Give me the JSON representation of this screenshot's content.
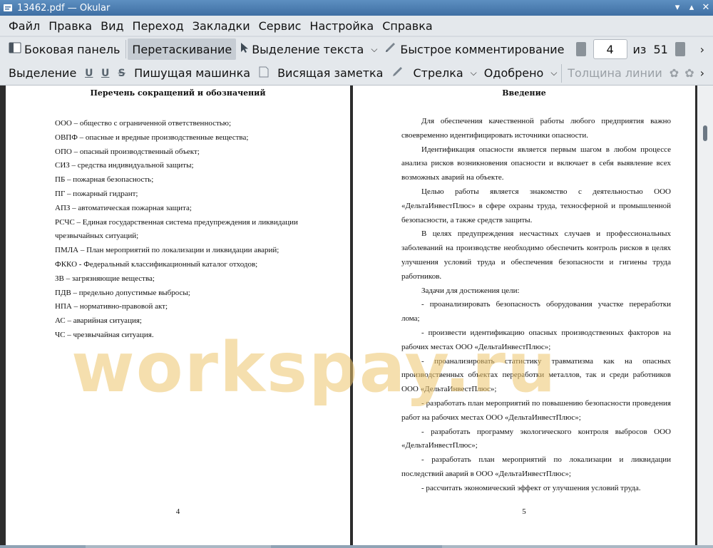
{
  "window": {
    "title": "13462.pdf — Okular"
  },
  "menu": [
    "Файл",
    "Правка",
    "Вид",
    "Переход",
    "Закладки",
    "Сервис",
    "Настройка",
    "Справка"
  ],
  "toolbar1": {
    "sidebar": "Боковая панель",
    "browse": "Перетаскивание",
    "text_select": "Выделение текста",
    "quick_annotate": "Быстрое комментирование",
    "page_current": "4",
    "page_of": "из",
    "page_total": "51"
  },
  "toolbar2": {
    "highlight": "Выделение",
    "typewriter": "Пишущая машинка",
    "popup_note": "Висящая заметка",
    "arrow": "Стрелка",
    "approved": "Одобрено",
    "line_width": "Толщина линии"
  },
  "left_page": {
    "heading": "Перечень сокращений и обозначений",
    "items": [
      "ООО – общество с ограниченной ответственностью;",
      "ОВПФ – опасные и вредные производственные вещества;",
      "ОПО – опасный производственный объект;",
      "СИЗ – средства индивидуальной защиты;",
      "ПБ – пожарная безопасность;",
      "ПГ – пожарный гидрант;",
      "АПЗ – автоматическая пожарная защита;",
      "РСЧС – Единая  государственная система предупреждения и ликвидации чрезвычайных ситуаций;",
      "ПМЛА – План мероприятий по локализации и ликвидации аварий;",
      "ФККО - Федеральный классификационный каталог отходов;",
      "ЗВ – загрязняющие вещества;",
      "ПДВ – предельно допустимые выбросы;",
      "НПА – нормативно-правовой акт;",
      "АС – аварийная ситуация;",
      "ЧС – чрезвычайная ситуация."
    ],
    "page_number": "4"
  },
  "right_page": {
    "heading": "Введение",
    "paragraphs": [
      "Для обеспечения качественной работы любого предприятия важно своевременно идентифицировать источники опасности.",
      "Идентификация опасности является первым шагом в любом процессе анализа рисков возникновения опасности и включает в себя выявление всех возможных аварий на объекте.",
      "Целью работы является знакомство с деятельностью ООО «ДельтаИнвестПлюс» в сфере охраны труда, техносферной и промышленной безопасности, а также средств защиты.",
      "В целях предупреждения несчастных случаев и профессиональных заболеваний на производстве необходимо обеспечить контроль рисков в целях улучшения условий труда и обеспечения безопасности и гигиены труда работников.",
      "Задачи для достижения цели:",
      "- проанализировать безопасность оборудования участке переработки лома;",
      "- произвести идентификацию опасных производственных факторов на рабочих местах ООО «ДельтаИнвестПлюс»;",
      "- проанализировать статистику травматизма как на опасных производственных объектах переработки металлов, так и среди работников ООО «ДельтаИнвестПлюс»;",
      "- разработать план мероприятий по повышению безопасности проведения работ на рабочих местах ООО «ДельтаИнвестПлюс»;",
      "- разработать программу экологического контроля выбросов ООО «ДельтаИнвестПлюс»;",
      "- разработать план мероприятий по локализации и ликвидации последствий аварий в ООО «ДельтаИнвестПлюс»;",
      "- рассчитать экономический эффект от улучшения условий труда."
    ],
    "page_number": "5"
  },
  "watermark": "workspay.ru"
}
